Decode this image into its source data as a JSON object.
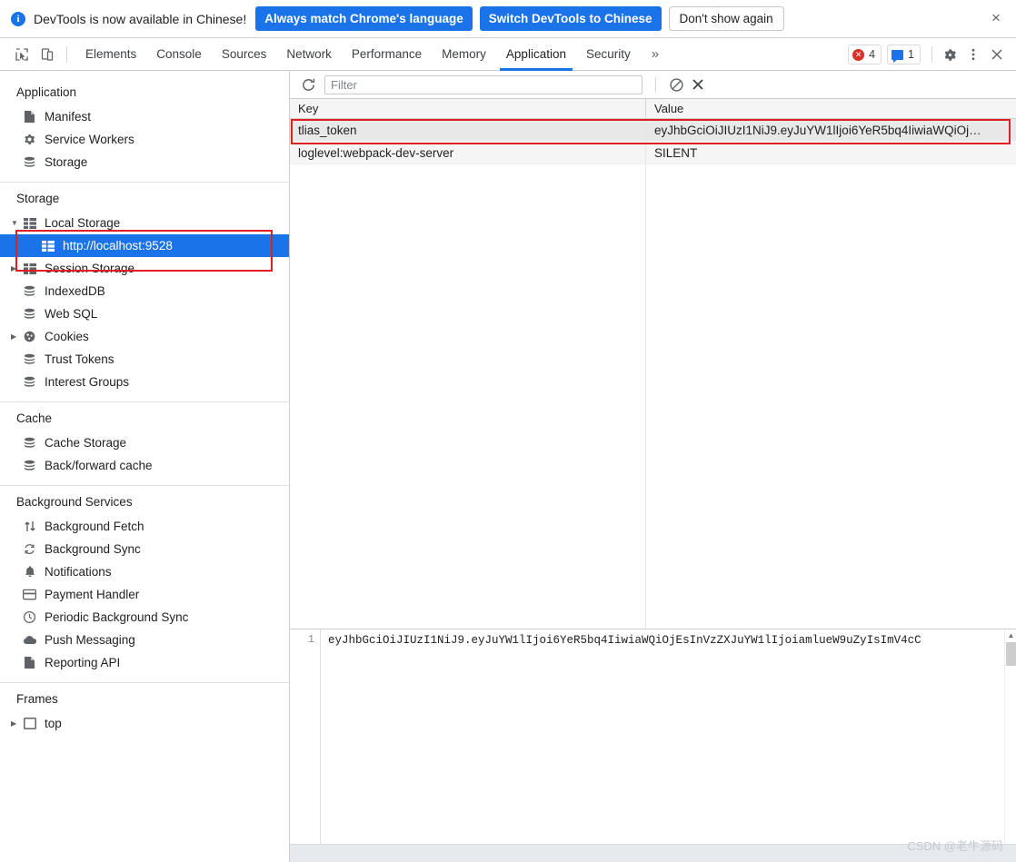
{
  "infobar": {
    "icon": "info-icon",
    "message": "DevTools is now available in Chinese!",
    "primary_button_1": "Always match Chrome's language",
    "primary_button_2": "Switch DevTools to Chinese",
    "secondary_button": "Don't show again",
    "close": "×",
    "accent_color": "#1a73e8"
  },
  "tabbar": {
    "inspect_icon": "cursor-select-icon",
    "device_icon": "device-toggle-icon",
    "tabs": [
      {
        "label": "Elements",
        "active": false
      },
      {
        "label": "Console",
        "active": false
      },
      {
        "label": "Sources",
        "active": false
      },
      {
        "label": "Network",
        "active": false
      },
      {
        "label": "Performance",
        "active": false
      },
      {
        "label": "Memory",
        "active": false
      },
      {
        "label": "Application",
        "active": true
      },
      {
        "label": "Security",
        "active": false
      }
    ],
    "more_tabs": "»",
    "error_badge": {
      "icon": "error-circle-icon",
      "count": "4"
    },
    "message_badge": {
      "icon": "message-icon",
      "count": "1"
    },
    "settings_icon": "gear-icon",
    "more_icon": "kebab-menu-icon",
    "close_icon": "close-icon",
    "annotation_color": "#e02020",
    "active_underline_color": "#1a73e8"
  },
  "sidebar": {
    "sections": [
      {
        "title": "Application",
        "items": [
          {
            "label": "Manifest",
            "icon": "document-icon",
            "indent": 1,
            "twisty": "",
            "selected": false
          },
          {
            "label": "Service Workers",
            "icon": "gear-icon",
            "indent": 1,
            "twisty": "",
            "selected": false
          },
          {
            "label": "Storage",
            "icon": "database-icon",
            "indent": 1,
            "twisty": "",
            "selected": false
          }
        ]
      },
      {
        "title": "Storage",
        "items": [
          {
            "label": "Local Storage",
            "icon": "table-grid-icon",
            "indent": 1,
            "twisty": "▼",
            "selected": false
          },
          {
            "label": "http://localhost:9528",
            "icon": "table-grid-icon",
            "indent": 2,
            "twisty": "",
            "selected": true
          },
          {
            "label": "Session Storage",
            "icon": "table-grid-icon",
            "indent": 1,
            "twisty": "▶",
            "selected": false
          },
          {
            "label": "IndexedDB",
            "icon": "database-icon",
            "indent": 1,
            "twisty": "",
            "selected": false
          },
          {
            "label": "Web SQL",
            "icon": "database-icon",
            "indent": 1,
            "twisty": "",
            "selected": false
          },
          {
            "label": "Cookies",
            "icon": "cookie-icon",
            "indent": 1,
            "twisty": "▶",
            "selected": false
          },
          {
            "label": "Trust Tokens",
            "icon": "database-icon",
            "indent": 1,
            "twisty": "",
            "selected": false
          },
          {
            "label": "Interest Groups",
            "icon": "database-icon",
            "indent": 1,
            "twisty": "",
            "selected": false
          }
        ]
      },
      {
        "title": "Cache",
        "items": [
          {
            "label": "Cache Storage",
            "icon": "database-icon",
            "indent": 1,
            "twisty": "",
            "selected": false
          },
          {
            "label": "Back/forward cache",
            "icon": "database-icon",
            "indent": 1,
            "twisty": "",
            "selected": false
          }
        ]
      },
      {
        "title": "Background Services",
        "items": [
          {
            "label": "Background Fetch",
            "icon": "up-down-arrows-icon",
            "indent": 1,
            "twisty": "",
            "selected": false
          },
          {
            "label": "Background Sync",
            "icon": "sync-icon",
            "indent": 1,
            "twisty": "",
            "selected": false
          },
          {
            "label": "Notifications",
            "icon": "bell-icon",
            "indent": 1,
            "twisty": "",
            "selected": false
          },
          {
            "label": "Payment Handler",
            "icon": "credit-card-icon",
            "indent": 1,
            "twisty": "",
            "selected": false
          },
          {
            "label": "Periodic Background Sync",
            "icon": "clock-icon",
            "indent": 1,
            "twisty": "",
            "selected": false
          },
          {
            "label": "Push Messaging",
            "icon": "cloud-icon",
            "indent": 1,
            "twisty": "",
            "selected": false
          },
          {
            "label": "Reporting API",
            "icon": "document-icon",
            "indent": 1,
            "twisty": "",
            "selected": false
          }
        ]
      },
      {
        "title": "Frames",
        "items": [
          {
            "label": "top",
            "icon": "frame-icon",
            "indent": 1,
            "twisty": "▶",
            "selected": false
          }
        ]
      }
    ],
    "selection_color": "#1a73e8",
    "annotation_color": "#e02020"
  },
  "filterbar": {
    "refresh_icon": "refresh-icon",
    "filter_placeholder": "Filter",
    "filter_value": "",
    "clear_all_icon": "no-entry-icon",
    "delete_icon": "close-x-icon"
  },
  "table": {
    "columns": [
      "Key",
      "Value"
    ],
    "rows": [
      {
        "key": "tlias_token",
        "value": "eyJhbGciOiJIUzI1NiJ9.eyJuYW1lIjoi6YeR5bq4IiwiaWQiOj…",
        "selected": true
      },
      {
        "key": "loglevel:webpack-dev-server",
        "value": "SILENT",
        "selected": false
      }
    ]
  },
  "preview": {
    "line_number": "1",
    "content": "eyJhbGciOiJIUzI1NiJ9.eyJuYW1lIjoi6YeR5bq4IiwiaWQiOjEsInVzZXJuYW1lIjoiamlueW9uZyIsImV4cC",
    "hscroll_left_arrow": "◂",
    "hscroll_right_arrow": "▸",
    "vscroll_up_arrow": "▲"
  },
  "watermark": "CSDN @老牛源码"
}
